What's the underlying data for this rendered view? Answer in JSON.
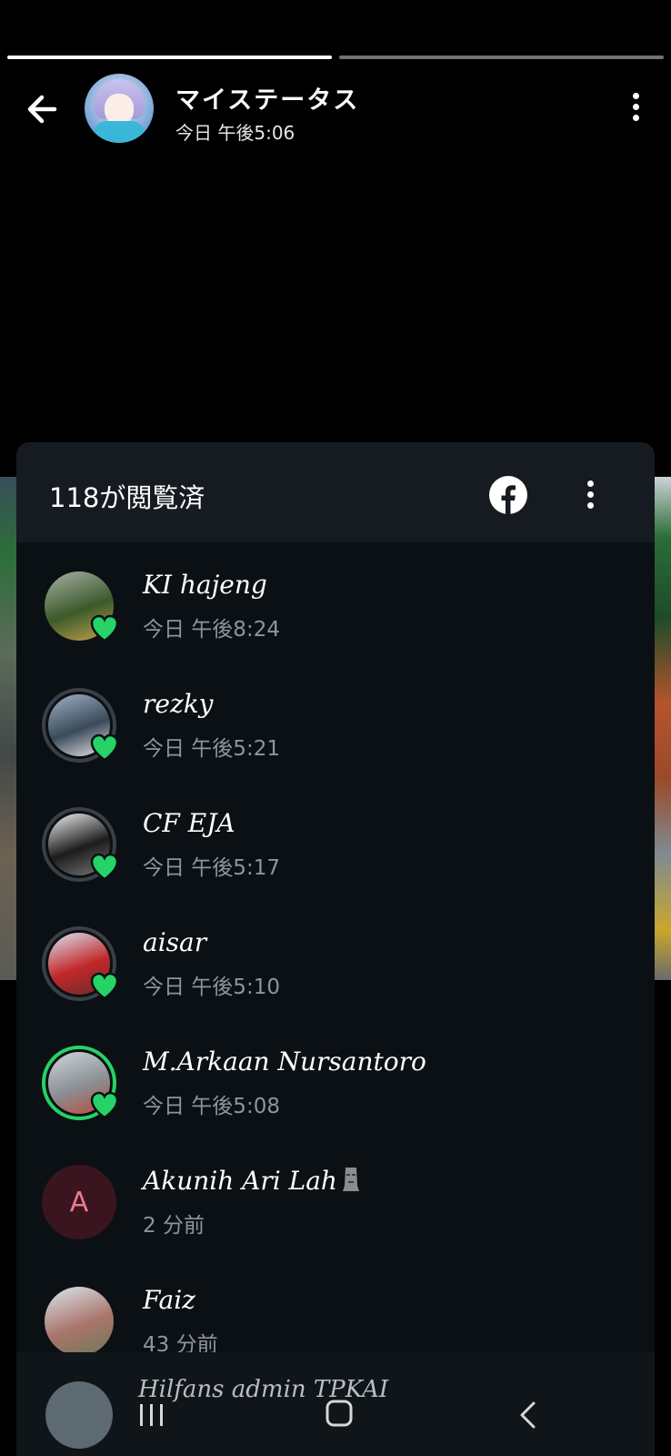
{
  "status": {
    "title": "マイステータス",
    "time": "今日 午後5:06",
    "segments": [
      1,
      0
    ]
  },
  "sheet": {
    "view_count_label": "118が閲覧済"
  },
  "viewers": [
    {
      "name": "KI hajeng",
      "time": "今日 午後8:24",
      "ring": "none",
      "liked": true,
      "avatar_colors": [
        "#a9b1a6",
        "#3a5a2a",
        "#c7a34a"
      ]
    },
    {
      "name": "rezky",
      "time": "今日 午後5:21",
      "ring": "grey",
      "liked": true,
      "avatar_colors": [
        "#9fb3c4",
        "#3a4a5a",
        "#e8e8e8"
      ]
    },
    {
      "name": "CF EJA",
      "time": "今日 午後5:17",
      "ring": "grey",
      "liked": true,
      "avatar_colors": [
        "#f2f2f2",
        "#1c1c1c",
        "#777777"
      ]
    },
    {
      "name": "aisar",
      "time": "今日 午後5:10",
      "ring": "grey",
      "liked": true,
      "avatar_colors": [
        "#d9e6f2",
        "#c2282a",
        "#6a2a2a"
      ]
    },
    {
      "name": "M.Arkaan Nursantoro",
      "time": "今日 午後5:08",
      "ring": "green",
      "liked": true,
      "avatar_colors": [
        "#cfd6da",
        "#8a8f94",
        "#b94b3a"
      ]
    },
    {
      "name": "Akunih Ari Lah",
      "time": "2 分前",
      "ring": "none",
      "liked": false,
      "letter": "A"
    },
    {
      "name": "Faiz",
      "time": "43 分前",
      "ring": "none",
      "liked": false,
      "avatar_colors": [
        "#dbe6ee",
        "#a9756a",
        "#6d7a5a"
      ]
    }
  ],
  "partial_viewer": {
    "name": "Hilfans admin TPKAI"
  },
  "colors": {
    "accent_green": "#25d366",
    "sheet_bg": "#0b1014",
    "sheet_head_bg": "#151b20"
  }
}
